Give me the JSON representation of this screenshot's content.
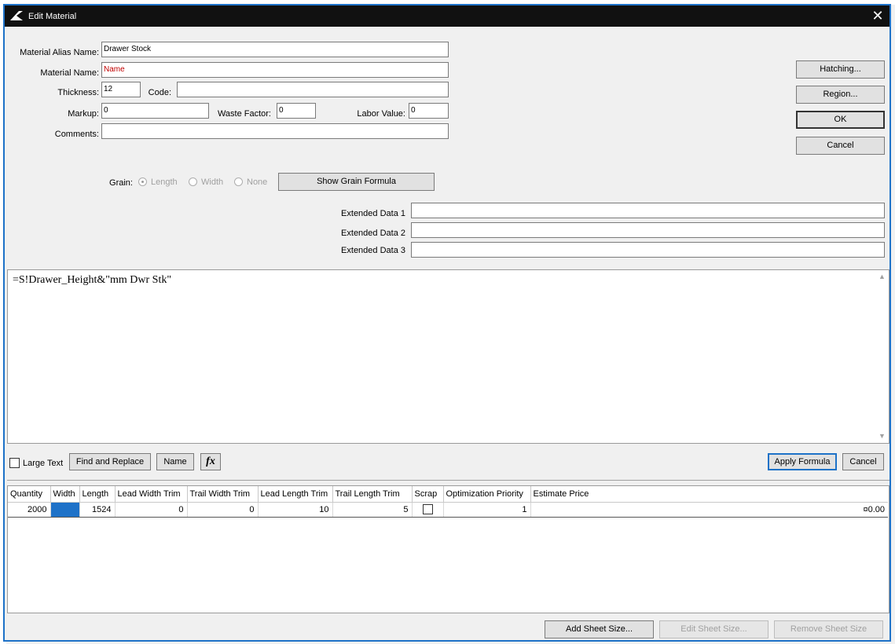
{
  "window": {
    "title": "Edit Material",
    "close_glyph": "✕"
  },
  "form": {
    "alias_label": "Material Alias Name:",
    "alias_value": "Drawer Stock",
    "name_label": "Material Name:",
    "name_value": "Name",
    "thickness_label": "Thickness:",
    "thickness_value": "12",
    "code_label": "Code:",
    "code_value": "",
    "markup_label": "Markup:",
    "markup_value": "0",
    "waste_label": "Waste Factor:",
    "waste_value": "0",
    "labor_label": "Labor Value:",
    "labor_value": "0",
    "comments_label": "Comments:",
    "comments_value": ""
  },
  "side_buttons": {
    "hatching": "Hatching...",
    "region": "Region...",
    "ok": "OK",
    "cancel": "Cancel"
  },
  "grain": {
    "label": "Grain:",
    "options": [
      "Length",
      "Width",
      "None"
    ],
    "selected": "Length",
    "formula_button": "Show Grain Formula"
  },
  "extended": {
    "data1_label": "Extended Data 1",
    "data2_label": "Extended Data 2",
    "data3_label": "Extended Data 3",
    "data1_value": "",
    "data2_value": "",
    "data3_value": ""
  },
  "formula": {
    "text": "=S!Drawer_Height&\"mm Dwr Stk\"",
    "large_text_label": "Large Text",
    "find_replace": "Find and Replace",
    "name_button": "Name",
    "fx_glyph": "fx",
    "apply": "Apply Formula",
    "cancel": "Cancel"
  },
  "sheet_table": {
    "headers": [
      "Quantity",
      "Width",
      "Length",
      "Lead Width Trim",
      "Trail Width Trim",
      "Lead Length Trim",
      "Trail Length Trim",
      "Scrap",
      "Optimization Priority",
      "Estimate Price"
    ],
    "rows": [
      {
        "quantity": "2000",
        "width": "",
        "length": "1524",
        "lead_width_trim": "0",
        "trail_width_trim": "0",
        "lead_length_trim": "10",
        "trail_length_trim": "5",
        "scrap": false,
        "optimization_priority": "1",
        "estimate_price": "¤0.00"
      }
    ]
  },
  "footer": {
    "add": "Add Sheet Size...",
    "edit": "Edit Sheet Size...",
    "remove": "Remove Sheet Size"
  },
  "colors": {
    "accent": "#1e72c8",
    "titlebar": "#111111",
    "name_text": "#c00000"
  },
  "icons": {
    "app": "app-logo-icon",
    "close": "close-icon",
    "fx": "fx-icon"
  }
}
